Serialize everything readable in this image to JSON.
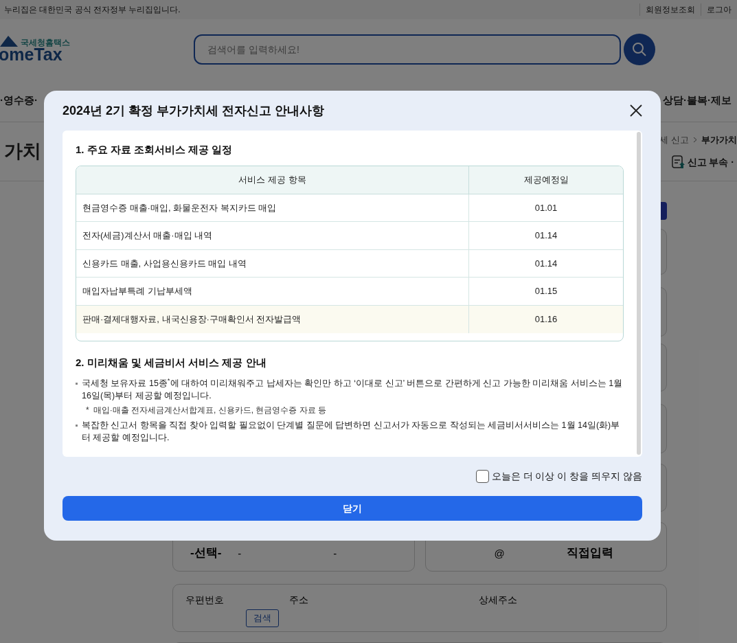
{
  "page": {
    "notice": "누리집은 대한민국 공식 전자정부 누리집입니다.",
    "top_links": [
      "회원정보조회",
      "로그아"
    ],
    "logo_caption": "국세청홈택스",
    "logo_text": "omeTax",
    "search": {
      "placeholder": "검색어를 입력하세요!"
    },
    "nav": [
      "·영수증·",
      "상담·불복·제보"
    ],
    "breadcrumb": [
      "세 신고",
      "부가가치"
    ],
    "title": "가치",
    "attach_link": "신고 부속 ·",
    "phone": [
      "-선택-",
      "-",
      "-"
    ],
    "email": [
      "@",
      "직접입력"
    ],
    "address_labels": [
      "우편번호",
      "주소",
      "상세주소"
    ],
    "address_button": "검색"
  },
  "dialog": {
    "title": "2024년 2기 확정 부가가치세 전자신고 안내사항",
    "section_1": {
      "heading": "1. 주요 자료 조회서비스 제공 일정",
      "columns": [
        "서비스 제공 항목",
        "제공예정일"
      ],
      "rows": [
        {
          "item": "현금영수증 매출·매입, 화물운전자 복지카드 매입",
          "date": "01.01",
          "highlighted": false
        },
        {
          "item": "전자(세금)계산서 매출·매입 내역",
          "date": "01.14",
          "highlighted": false
        },
        {
          "item": "신용카드 매출, 사업용신용카드 매입 내역",
          "date": "01.14",
          "highlighted": false
        },
        {
          "item": "매입자납부특례 기납부세액",
          "date": "01.15",
          "highlighted": false
        },
        {
          "item": "판매·결제대행자료, 내국신용장·구매확인서 전자발급액",
          "date": "01.16",
          "highlighted": true
        }
      ]
    },
    "section_2": {
      "heading": "2. 미리채움 및 세금비서 서비스 제공 안내",
      "items": [
        {
          "kind": "bullet",
          "text": "국세청 보유자료 15종$^{*}$에 대하여 미리채워주고 납세자는 확인만 하고 ‘이대로 신고’ 버튼으로 간편하게 신고 가능한 미리채움 서비스는 1월 16일(목)부터 제공할 예정입니다."
        },
        {
          "kind": "note",
          "marker": "*",
          "text": "매입·매출 전자세금계산서합계표, 신용카드, 현금영수증 자료 등"
        },
        {
          "kind": "bullet",
          "text": "복잡한 신고서 항목을 직접 찾아 입력할 필요없이 단계별 질문에 답변하면 신고서가 자동으로 작성되는 세금비서서비스는 1월 14일(화)부터 제공할 예정입니다."
        }
      ]
    },
    "dont_show_today": {
      "label": "오늘은 더 이상 이 창을 띄우지 않음",
      "checked": false
    },
    "close_button": "닫기"
  }
}
